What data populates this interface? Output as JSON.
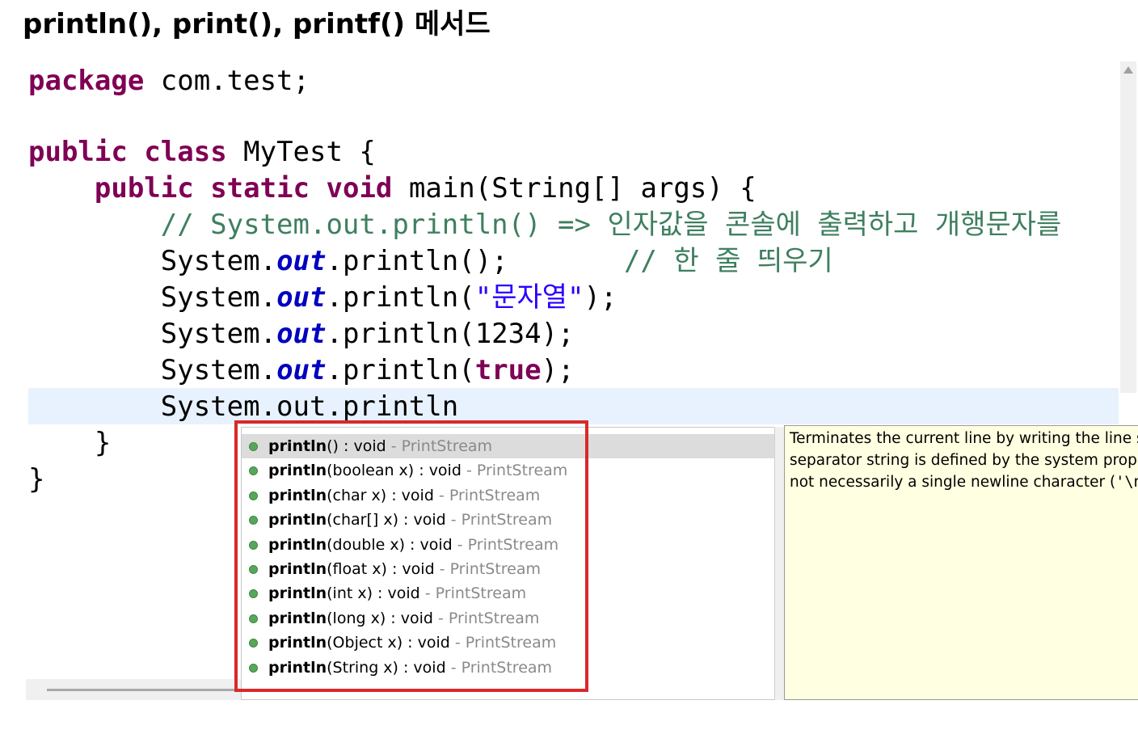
{
  "page_title": "println(), print(), printf() 메서드",
  "editor": {
    "line1": {
      "kw": "package",
      "rest": " com.test;"
    },
    "line2": {
      "kw1": "public",
      "kw2": "class",
      "rest": " MyTest {"
    },
    "line3": {
      "kw1": "public",
      "kw2": "static",
      "kw3": "void",
      "rest": " main(String[] args) {"
    },
    "line4": {
      "comment": "// System.out.println() => 인자값을 콘솔에 출력하고 개행문자를"
    },
    "line5": {
      "sys": "System.",
      "field": "out",
      "call": ".println();",
      "gap": "       ",
      "comment": "// 한 줄 띄우기"
    },
    "line6": {
      "sys": "System.",
      "field": "out",
      "call": ".println(",
      "string": "\"문자열\"",
      "end": ");"
    },
    "line7": {
      "sys": "System.",
      "field": "out",
      "call": ".println(1234);"
    },
    "line8": {
      "sys": "System.",
      "field": "out",
      "call": ".println(",
      "kw": "true",
      "end": ");"
    },
    "line9": {
      "text": "System.out.println"
    },
    "line10": {
      "text": "}"
    },
    "line11": {
      "text": "}"
    }
  },
  "completion": {
    "items": [
      {
        "name": "println",
        "params": "() : void",
        "sep": " - ",
        "qualifier": "PrintStream"
      },
      {
        "name": "println",
        "params": "(boolean x) : void",
        "sep": " - ",
        "qualifier": "PrintStream"
      },
      {
        "name": "println",
        "params": "(char x) : void",
        "sep": " - ",
        "qualifier": "PrintStream"
      },
      {
        "name": "println",
        "params": "(char[] x) : void",
        "sep": " - ",
        "qualifier": "PrintStream"
      },
      {
        "name": "println",
        "params": "(double x) : void",
        "sep": " - ",
        "qualifier": "PrintStream"
      },
      {
        "name": "println",
        "params": "(float x) : void",
        "sep": " - ",
        "qualifier": "PrintStream"
      },
      {
        "name": "println",
        "params": "(int x) : void",
        "sep": " - ",
        "qualifier": "PrintStream"
      },
      {
        "name": "println",
        "params": "(long x) : void",
        "sep": " - ",
        "qualifier": "PrintStream"
      },
      {
        "name": "println",
        "params": "(Object x) : void",
        "sep": " - ",
        "qualifier": "PrintStream"
      },
      {
        "name": "println",
        "params": "(String x) : void",
        "sep": " - ",
        "qualifier": "PrintStream"
      }
    ]
  },
  "javadoc": {
    "line1": "Terminates the current line by writing the line se",
    "line2": "separator string is defined by the system propert",
    "line3_prefix": "not necessarily a single newline character (",
    "line3_code": "'\\n'",
    "line3_suffix": ")."
  },
  "colors": {
    "keyword": "#7f0055",
    "comment": "#3f7f5f",
    "string": "#2a00ff",
    "field": "#0000c0",
    "highlight_box": "#d9292a",
    "current_line": "#e8f2fe",
    "javadoc_bg": "#ffffe1"
  }
}
